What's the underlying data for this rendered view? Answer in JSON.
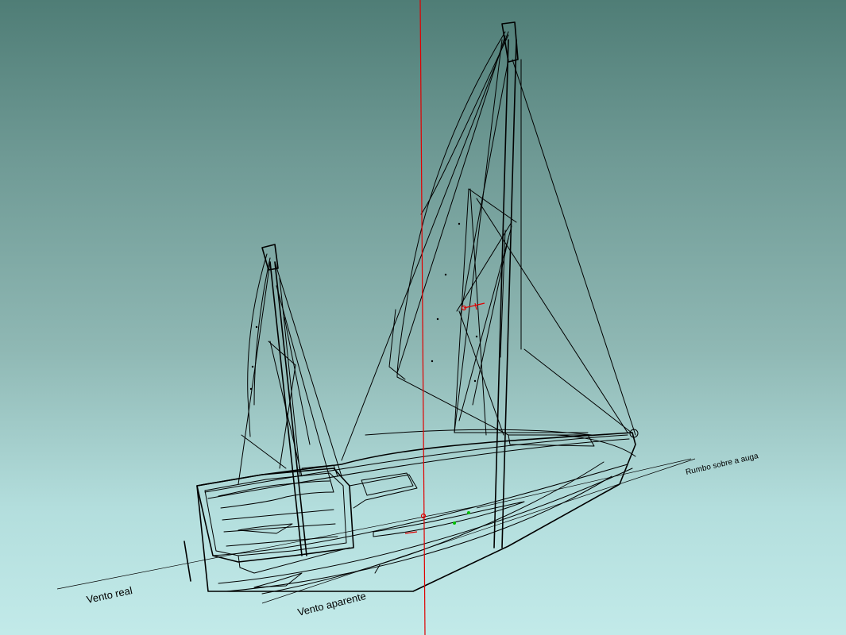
{
  "labels": {
    "true_wind": "Vento real",
    "apparent_wind": "Vento aparente",
    "course": "Rumbo sobre a auga"
  },
  "colors": {
    "background_top": "#4f7d76",
    "background_bottom": "#c2eae9",
    "wireframe": "#000000",
    "axis_marker": "#e00000",
    "point_marker": "#00c000"
  }
}
